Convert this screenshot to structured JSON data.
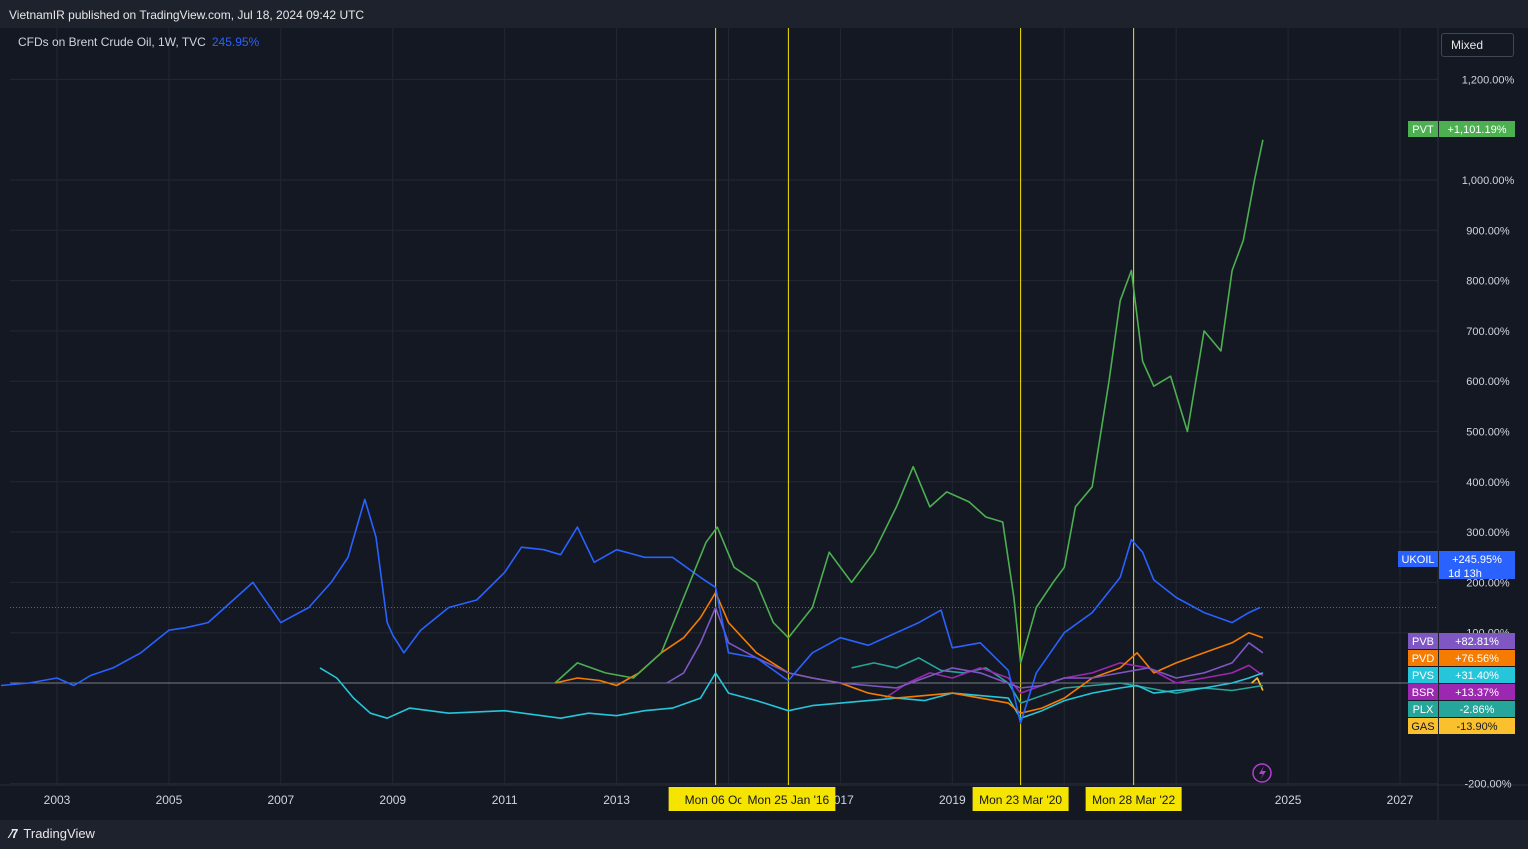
{
  "header": {
    "published": "VietnamIR published on TradingView.com, Jul 18, 2024 09:42 UTC"
  },
  "legend": {
    "symbol": "CFDs on Brent Crude Oil, 1W, TVC",
    "value": "245.95%"
  },
  "toolbar": {
    "scale_mode": "Mixed"
  },
  "footer": {
    "brand": "TradingView"
  },
  "colors": {
    "background": "#141823",
    "UKOIL": "#2962ff",
    "PVT": "#4caf50",
    "PVB": "#7e57c2",
    "PVD": "#f57c00",
    "PVS": "#26c6da",
    "BSR": "#9c27b0",
    "PLX": "#26a69a",
    "GAS": "#fbc02d",
    "marker_line": "#f5e400"
  },
  "chart_data": {
    "type": "line",
    "title": "CFDs on Brent Crude Oil, 1W, TVC",
    "ylabel": "",
    "y_unit": "%",
    "ylim": [
      -200,
      1200
    ],
    "xlim": [
      2002.0,
      2028.0
    ],
    "y_ticks": [
      "1,200.00%",
      "1,000.00%",
      "900.00%",
      "800.00%",
      "700.00%",
      "600.00%",
      "500.00%",
      "400.00%",
      "300.00%",
      "200.00%",
      "100.00%",
      "-200.00%"
    ],
    "x_ticks": [
      "2003",
      "2005",
      "2007",
      "2009",
      "2011",
      "2013",
      "2017",
      "2019",
      "2025",
      "2027"
    ],
    "markers": [
      {
        "date": 2014.77,
        "label": "Mon 06 Oct"
      },
      {
        "date": 2016.07,
        "label": "Mon 25 Jan '16"
      },
      {
        "date": 2020.22,
        "label": "Mon 23 Mar '20"
      },
      {
        "date": 2022.24,
        "label": "Mon 28 Mar '22"
      }
    ],
    "series": [
      {
        "name": "UKOIL",
        "last": "+245.95%",
        "countdown": "1d 13h",
        "x": [
          2002.0,
          2002.5,
          2003.0,
          2003.3,
          2003.6,
          2004.0,
          2004.5,
          2005.0,
          2005.3,
          2005.7,
          2006.0,
          2006.5,
          2007.0,
          2007.5,
          2007.9,
          2008.2,
          2008.5,
          2008.7,
          2008.9,
          2009.0,
          2009.2,
          2009.5,
          2010.0,
          2010.5,
          2011.0,
          2011.3,
          2011.7,
          2012.0,
          2012.3,
          2012.6,
          2013.0,
          2013.5,
          2014.0,
          2014.5,
          2014.77,
          2015.0,
          2015.5,
          2016.0,
          2016.07,
          2016.5,
          2017.0,
          2017.5,
          2018.0,
          2018.4,
          2018.8,
          2019.0,
          2019.5,
          2020.0,
          2020.22,
          2020.5,
          2021.0,
          2021.5,
          2022.0,
          2022.2,
          2022.4,
          2022.6,
          2023.0,
          2023.5,
          2024.0,
          2024.3,
          2024.5
        ],
        "y": [
          -5,
          0,
          10,
          -5,
          15,
          30,
          60,
          105,
          110,
          120,
          150,
          200,
          120,
          150,
          200,
          250,
          365,
          290,
          120,
          95,
          60,
          105,
          150,
          165,
          220,
          270,
          265,
          255,
          310,
          240,
          265,
          250,
          250,
          210,
          190,
          60,
          50,
          10,
          5,
          60,
          90,
          75,
          100,
          120,
          145,
          70,
          80,
          25,
          -80,
          20,
          100,
          140,
          210,
          285,
          260,
          205,
          170,
          140,
          120,
          140,
          150
        ]
      },
      {
        "name": "PVT",
        "last": "+1,101.19%",
        "x": [
          2011.9,
          2012.3,
          2012.8,
          2013.3,
          2013.8,
          2014.2,
          2014.6,
          2014.8,
          2015.1,
          2015.5,
          2015.8,
          2016.07,
          2016.5,
          2016.8,
          2017.2,
          2017.6,
          2018.0,
          2018.3,
          2018.6,
          2018.9,
          2019.3,
          2019.6,
          2019.9,
          2020.1,
          2020.22,
          2020.5,
          2020.8,
          2021.0,
          2021.2,
          2021.5,
          2021.8,
          2022.0,
          2022.2,
          2022.4,
          2022.6,
          2022.9,
          2023.2,
          2023.5,
          2023.8,
          2024.0,
          2024.2,
          2024.4,
          2024.55
        ],
        "y": [
          0,
          40,
          20,
          10,
          60,
          170,
          280,
          310,
          230,
          200,
          120,
          90,
          150,
          260,
          200,
          260,
          350,
          430,
          350,
          380,
          360,
          330,
          320,
          170,
          40,
          150,
          200,
          230,
          350,
          390,
          600,
          760,
          820,
          640,
          590,
          610,
          500,
          700,
          660,
          820,
          880,
          1000,
          1080
        ]
      },
      {
        "name": "PVB",
        "last": "+82.81%",
        "x": [
          2013.9,
          2014.2,
          2014.5,
          2014.77,
          2015.0,
          2015.5,
          2016.07,
          2016.5,
          2017.0,
          2017.5,
          2018.0,
          2018.5,
          2019.0,
          2019.5,
          2020.22,
          2020.6,
          2021.0,
          2021.5,
          2022.0,
          2022.5,
          2023.0,
          2023.5,
          2024.0,
          2024.3,
          2024.55
        ],
        "y": [
          0,
          20,
          80,
          150,
          80,
          50,
          20,
          10,
          0,
          -5,
          -10,
          10,
          30,
          20,
          -10,
          -5,
          10,
          10,
          20,
          30,
          10,
          20,
          40,
          80,
          60
        ]
      },
      {
        "name": "PVD",
        "last": "+76.56%",
        "x": [
          2011.9,
          2012.3,
          2012.7,
          2013.0,
          2013.4,
          2013.8,
          2014.2,
          2014.5,
          2014.77,
          2015.0,
          2015.5,
          2016.07,
          2016.5,
          2017.0,
          2017.5,
          2018.0,
          2018.5,
          2019.0,
          2019.5,
          2020.0,
          2020.22,
          2020.6,
          2021.0,
          2021.5,
          2022.0,
          2022.3,
          2022.6,
          2023.0,
          2023.5,
          2024.0,
          2024.3,
          2024.55
        ],
        "y": [
          0,
          10,
          5,
          -5,
          20,
          60,
          90,
          130,
          180,
          120,
          60,
          20,
          10,
          0,
          -20,
          -30,
          -25,
          -20,
          -30,
          -40,
          -60,
          -50,
          -30,
          10,
          30,
          60,
          20,
          40,
          60,
          80,
          100,
          90
        ]
      },
      {
        "name": "PVS",
        "last": "+31.40%",
        "x": [
          2007.7,
          2008.0,
          2008.3,
          2008.6,
          2008.9,
          2009.3,
          2010.0,
          2011.0,
          2012.0,
          2012.5,
          2013.0,
          2013.5,
          2014.0,
          2014.5,
          2014.77,
          2015.0,
          2015.5,
          2016.07,
          2016.5,
          2017.0,
          2017.5,
          2018.0,
          2018.5,
          2019.0,
          2019.5,
          2020.0,
          2020.22,
          2020.6,
          2021.0,
          2021.5,
          2022.0,
          2022.3,
          2022.6,
          2023.0,
          2023.5,
          2024.0,
          2024.3,
          2024.55
        ],
        "y": [
          30,
          10,
          -30,
          -60,
          -70,
          -50,
          -60,
          -55,
          -70,
          -60,
          -65,
          -55,
          -50,
          -30,
          20,
          -20,
          -35,
          -55,
          -45,
          -40,
          -35,
          -30,
          -35,
          -20,
          -25,
          -30,
          -70,
          -55,
          -35,
          -20,
          -10,
          -5,
          -20,
          -15,
          -10,
          0,
          10,
          20
        ]
      },
      {
        "name": "BSR",
        "last": "+13.37%",
        "x": [
          2017.8,
          2018.2,
          2018.6,
          2019.0,
          2019.5,
          2020.0,
          2020.22,
          2020.6,
          2021.0,
          2021.5,
          2022.0,
          2022.5,
          2023.0,
          2023.5,
          2024.0,
          2024.3,
          2024.55
        ],
        "y": [
          -30,
          0,
          20,
          10,
          30,
          10,
          -20,
          -5,
          10,
          20,
          40,
          30,
          0,
          10,
          20,
          35,
          15
        ]
      },
      {
        "name": "PLX",
        "last": "-2.86%",
        "x": [
          2017.2,
          2017.6,
          2018.0,
          2018.4,
          2018.8,
          2019.2,
          2019.6,
          2020.0,
          2020.22,
          2020.6,
          2021.0,
          2021.5,
          2022.0,
          2022.5,
          2023.0,
          2023.5,
          2024.0,
          2024.55
        ],
        "y": [
          30,
          40,
          30,
          50,
          25,
          20,
          30,
          0,
          -40,
          -25,
          -10,
          -5,
          0,
          -10,
          -20,
          -10,
          -15,
          -5
        ]
      },
      {
        "name": "GAS",
        "last": "-13.90%",
        "x": [
          2024.35,
          2024.45,
          2024.55
        ],
        "y": [
          0,
          10,
          -15
        ]
      }
    ]
  }
}
